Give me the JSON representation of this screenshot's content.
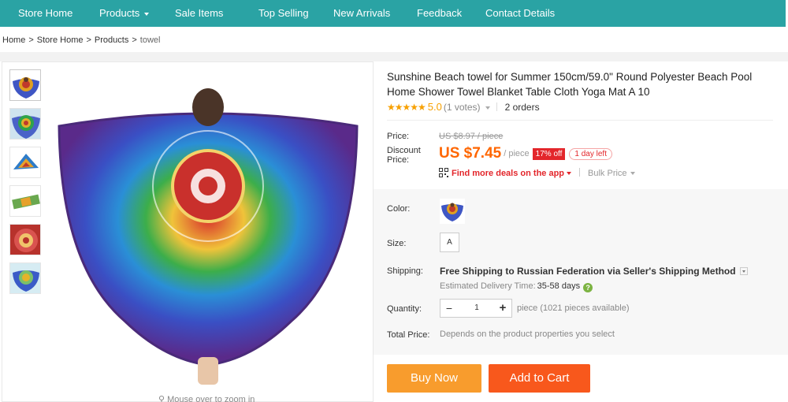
{
  "nav": {
    "items": [
      {
        "label": "Store Home",
        "dropdown": false
      },
      {
        "label": "Products",
        "dropdown": true
      },
      {
        "label": "Sale Items",
        "dropdown": false
      },
      {
        "label": "Top Selling",
        "dropdown": false
      },
      {
        "label": "New Arrivals",
        "dropdown": false
      },
      {
        "label": "Feedback",
        "dropdown": false
      },
      {
        "label": "Contact Details",
        "dropdown": false
      }
    ],
    "bg_color": "#2aa3a4"
  },
  "breadcrumb": {
    "items": [
      "Home",
      "Store Home",
      "Products"
    ],
    "current": "towel",
    "separator": ">"
  },
  "gallery": {
    "thumbnail_count": 6,
    "active_index": 0,
    "zoom_hint": "Mouse over to zoom in"
  },
  "product": {
    "title": "Sunshine Beach towel for Summer 150cm/59.0\" Round Polyester Beach Pool Home Shower Towel Blanket Table Cloth Yoga Mat A 10",
    "rating": {
      "stars": "★★★★★",
      "score": "5.0",
      "votes": "(1 votes)",
      "orders": "2 orders"
    },
    "price": {
      "label": "Price:",
      "original": "US $8.97 / piece",
      "discount_label": "Discount Price:",
      "current": "US $7.45",
      "unit": "/ piece",
      "off_badge": "17% off",
      "days_left": "1 day left",
      "app_deal": "Find more deals on the app",
      "bulk": "Bulk Price"
    },
    "color": {
      "label": "Color:"
    },
    "size": {
      "label": "Size:",
      "value": "A"
    },
    "shipping": {
      "label": "Shipping:",
      "text_prefix": "Free Shipping to Russian Federation via Seller's Shipping Method",
      "estimate_label": "Estimated Delivery Time:",
      "estimate_value": "35-58 days",
      "help": "?"
    },
    "quantity": {
      "label": "Quantity:",
      "minus": "−",
      "value": "1",
      "plus": "+",
      "available": "piece (1021 pieces available)"
    },
    "total": {
      "label": "Total Price:",
      "text": "Depends on the product properties you select"
    },
    "buttons": {
      "buy_now": "Buy Now",
      "add_to_cart": "Add to Cart"
    }
  },
  "colors": {
    "accent_orange": "#f60",
    "buy_now": "#f89c2d",
    "add_to_cart": "#f8581c",
    "badge_red": "#e3262b",
    "stars": "#f7a000"
  }
}
